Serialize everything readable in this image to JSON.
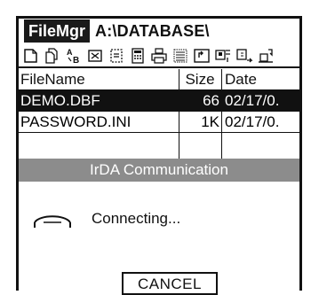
{
  "window": {
    "app_name": "FileMgr",
    "path": "A:\\DATABASE\\"
  },
  "toolbar": {
    "icons": [
      "new-file-icon",
      "copy-icon",
      "rename-icon",
      "delete-icon",
      "properties-icon",
      "calculator-icon",
      "print-icon",
      "list-view-icon",
      "up-folder-icon",
      "transfer-icon",
      "send-icon",
      "receive-icon"
    ]
  },
  "table": {
    "headers": {
      "name": "FileName",
      "size": "Size",
      "date": "Date"
    },
    "rows": [
      {
        "name": "DEMO.DBF",
        "size": "66",
        "date": "02/17/0.",
        "selected": true
      },
      {
        "name": "PASSWORD.INI",
        "size": "1K",
        "date": "02/17/0.",
        "selected": false
      }
    ]
  },
  "dialog": {
    "title": "IrDA Communication",
    "status": "Connecting...",
    "cancel_label": "CANCEL"
  },
  "colors": {
    "dialog_title_bg": "#8c8c8c",
    "selected_row_bg": "#111111"
  }
}
